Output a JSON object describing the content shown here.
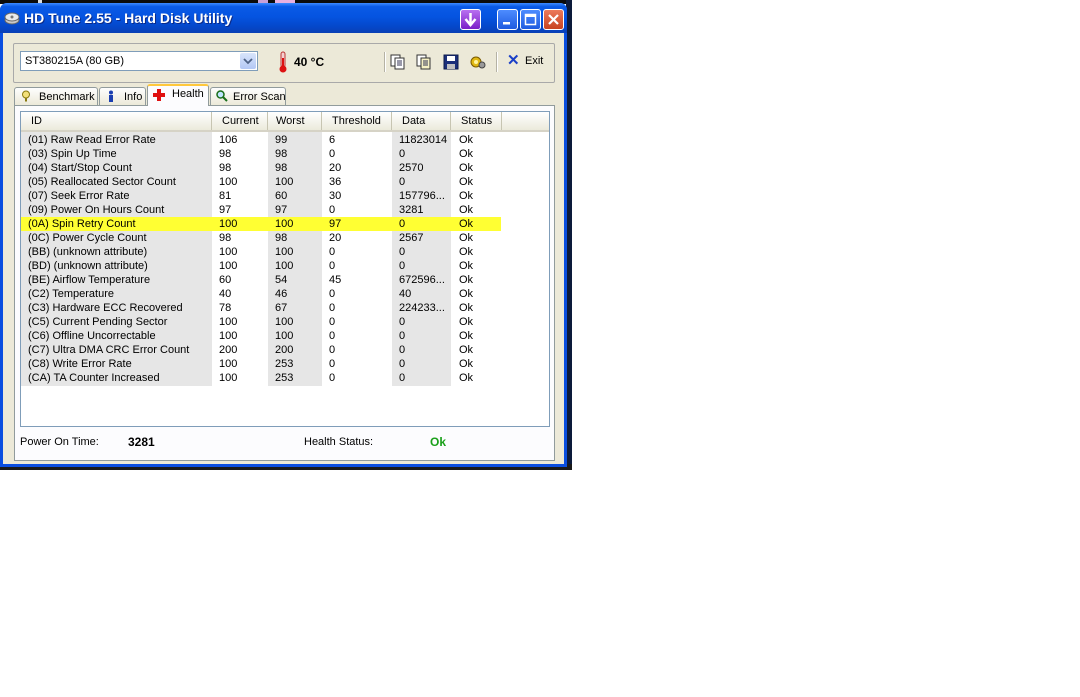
{
  "window": {
    "title": "HD Tune 2.55 - Hard Disk Utility"
  },
  "toolbar": {
    "drive": "ST380215A (80 GB)",
    "temperature": "40 °C",
    "exit_label": "Exit"
  },
  "tabs": [
    {
      "label": "Benchmark",
      "icon": "benchmark-icon"
    },
    {
      "label": "Info",
      "icon": "info-icon"
    },
    {
      "label": "Health",
      "icon": "health-icon",
      "active": true
    },
    {
      "label": "Error Scan",
      "icon": "magnifier-icon"
    }
  ],
  "table": {
    "columns": [
      "ID",
      "Current",
      "Worst",
      "Threshold",
      "Data",
      "Status"
    ],
    "rows": [
      {
        "id": "(01) Raw Read Error Rate",
        "current": "106",
        "worst": "99",
        "threshold": "6",
        "data": "11823014",
        "status": "Ok"
      },
      {
        "id": "(03) Spin Up Time",
        "current": "98",
        "worst": "98",
        "threshold": "0",
        "data": "0",
        "status": "Ok"
      },
      {
        "id": "(04) Start/Stop Count",
        "current": "98",
        "worst": "98",
        "threshold": "20",
        "data": "2570",
        "status": "Ok"
      },
      {
        "id": "(05) Reallocated Sector Count",
        "current": "100",
        "worst": "100",
        "threshold": "36",
        "data": "0",
        "status": "Ok"
      },
      {
        "id": "(07) Seek Error Rate",
        "current": "81",
        "worst": "60",
        "threshold": "30",
        "data": "157796...",
        "status": "Ok"
      },
      {
        "id": "(09) Power On Hours Count",
        "current": "97",
        "worst": "97",
        "threshold": "0",
        "data": "3281",
        "status": "Ok"
      },
      {
        "id": "(0A) Spin Retry Count",
        "current": "100",
        "worst": "100",
        "threshold": "97",
        "data": "0",
        "status": "Ok",
        "highlight": true
      },
      {
        "id": "(0C) Power Cycle Count",
        "current": "98",
        "worst": "98",
        "threshold": "20",
        "data": "2567",
        "status": "Ok"
      },
      {
        "id": "(BB) (unknown attribute)",
        "current": "100",
        "worst": "100",
        "threshold": "0",
        "data": "0",
        "status": "Ok"
      },
      {
        "id": "(BD) (unknown attribute)",
        "current": "100",
        "worst": "100",
        "threshold": "0",
        "data": "0",
        "status": "Ok"
      },
      {
        "id": "(BE) Airflow Temperature",
        "current": "60",
        "worst": "54",
        "threshold": "45",
        "data": "672596...",
        "status": "Ok"
      },
      {
        "id": "(C2) Temperature",
        "current": "40",
        "worst": "46",
        "threshold": "0",
        "data": "40",
        "status": "Ok"
      },
      {
        "id": "(C3) Hardware ECC Recovered",
        "current": "78",
        "worst": "67",
        "threshold": "0",
        "data": "224233...",
        "status": "Ok"
      },
      {
        "id": "(C5) Current Pending Sector",
        "current": "100",
        "worst": "100",
        "threshold": "0",
        "data": "0",
        "status": "Ok"
      },
      {
        "id": "(C6) Offline Uncorrectable",
        "current": "100",
        "worst": "100",
        "threshold": "0",
        "data": "0",
        "status": "Ok"
      },
      {
        "id": "(C7) Ultra DMA CRC Error Count",
        "current": "200",
        "worst": "200",
        "threshold": "0",
        "data": "0",
        "status": "Ok"
      },
      {
        "id": "(C8) Write Error Rate",
        "current": "100",
        "worst": "253",
        "threshold": "0",
        "data": "0",
        "status": "Ok"
      },
      {
        "id": "(CA) TA Counter Increased",
        "current": "100",
        "worst": "253",
        "threshold": "0",
        "data": "0",
        "status": "Ok"
      }
    ]
  },
  "footer": {
    "power_on_label": "Power On Time:",
    "power_on_value": "3281",
    "health_label": "Health Status:",
    "health_value": "Ok"
  },
  "colors": {
    "highlight_row": "#ffff33",
    "health_ok": "#1aa01a",
    "titlebar": "#0554e1"
  }
}
